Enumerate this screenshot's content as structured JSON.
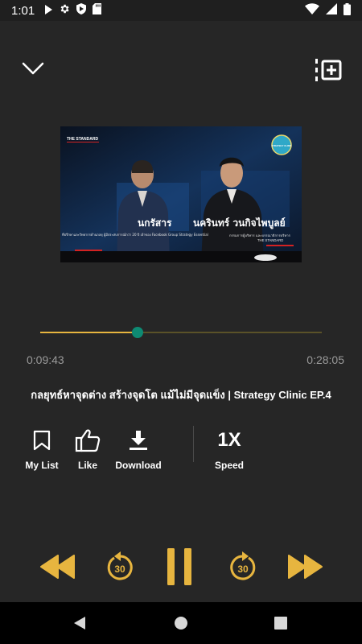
{
  "status_bar": {
    "time": "1:01",
    "icons": [
      "play-icon",
      "gear-icon",
      "shield-icon",
      "sd-card-icon",
      "wifi-icon",
      "signal-icon",
      "battery-icon"
    ]
  },
  "header": {
    "collapse_icon": "chevron-down-icon",
    "queue_icon": "playlist-add-icon"
  },
  "video": {
    "thumb_labels": {
      "brand": "THE STANDARD",
      "badge": "STRATEGY CLINIC",
      "guest_name_fragment": "นกรัสาร",
      "guest_caption": "ที่ปรึกษาและวิทยากรด้านกลยุ ผู้มีประสบการณ์กว่า 20 ปี เจ้าของ Facebook Group Strategy Essential",
      "host_name": "นครินทร์ วนกิจไพบูลย์",
      "host_title": "กรรมการผู้บริหาร และบรรณาธิการบริหาร",
      "host_org": "THE STANDARD"
    }
  },
  "player": {
    "elapsed": "0:09:43",
    "duration": "0:28:05",
    "progress": 0.347,
    "title": "กลยุทธ์หาจุดต่าง สร้างจุดโต แม้ไม่มีจุดแข็ง | Strategy Clinic EP.4"
  },
  "actions": {
    "my_list": "My List",
    "like": "Like",
    "download": "Download",
    "speed_value": "1X",
    "speed_label": "Speed"
  },
  "controls": {
    "skip_back_seconds": "30",
    "skip_forward_seconds": "30",
    "icons": [
      "rewind-icon",
      "replay-30-icon",
      "pause-icon",
      "forward-30-icon",
      "fast-forward-icon"
    ]
  },
  "colors": {
    "accent": "#e7b53f",
    "progress_thumb": "#0e8a73",
    "background": "#262626"
  },
  "nav_bar": {
    "icons": [
      "back-icon",
      "home-icon",
      "recents-icon"
    ]
  }
}
